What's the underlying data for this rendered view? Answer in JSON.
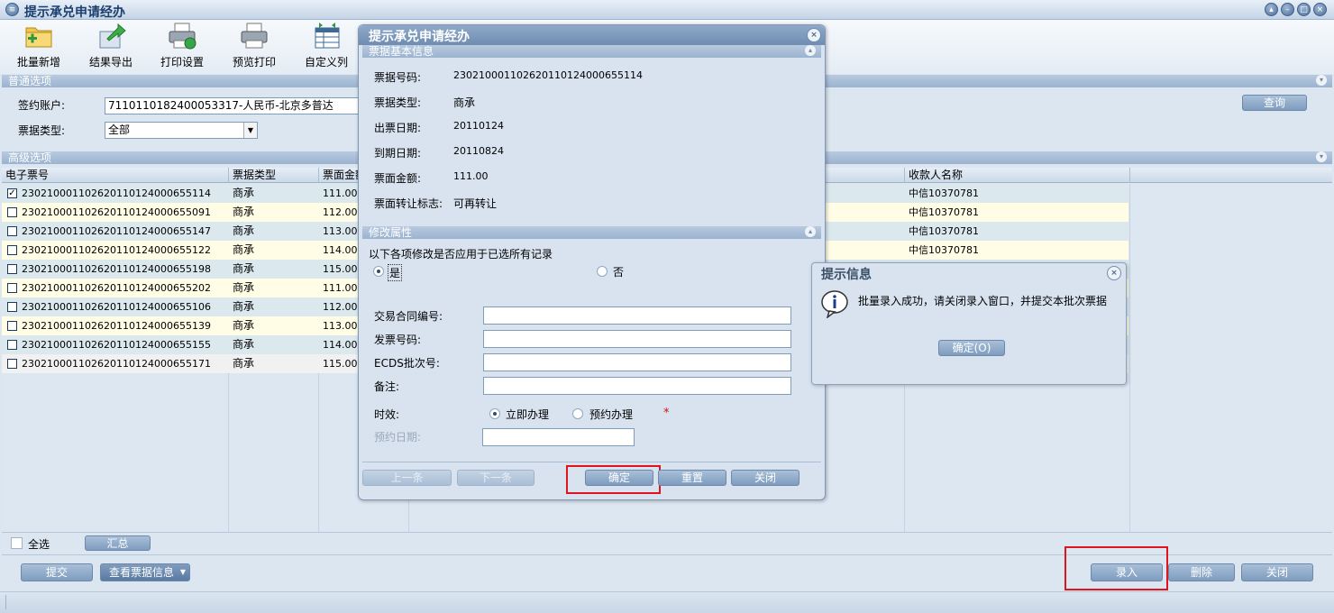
{
  "window": {
    "title": "提示承兑申请经办"
  },
  "toolbar": {
    "items": [
      {
        "label": "批量新增",
        "icon": "folder-add-icon"
      },
      {
        "label": "结果导出",
        "icon": "export-arrow-icon"
      },
      {
        "label": "打印设置",
        "icon": "printer-settings-icon"
      },
      {
        "label": "预览打印",
        "icon": "printer-preview-icon"
      },
      {
        "label": "自定义列",
        "icon": "custom-columns-icon"
      }
    ]
  },
  "normal_options": {
    "title": "普通选项",
    "account_label": "签约账户:",
    "account_value": "7110110182400053317-人民币-北京多普达",
    "type_label": "票据类型:",
    "type_value": "全部",
    "query_button": "查询"
  },
  "advanced_options": {
    "title": "高级选项"
  },
  "table": {
    "columns": [
      "电子票号",
      "票据类型",
      "票面金额",
      "收款人名称"
    ],
    "rows": [
      {
        "checked": true,
        "no": "230210001102620110124000655114",
        "type": "商承",
        "amount": "111.00",
        "payee": "中信10370781"
      },
      {
        "checked": false,
        "no": "230210001102620110124000655091",
        "type": "商承",
        "amount": "112.00",
        "payee": "中信10370781"
      },
      {
        "checked": false,
        "no": "230210001102620110124000655147",
        "type": "商承",
        "amount": "113.00",
        "payee": "中信10370781"
      },
      {
        "checked": false,
        "no": "230210001102620110124000655122",
        "type": "商承",
        "amount": "114.00",
        "payee": "中信10370781"
      },
      {
        "checked": false,
        "no": "230210001102620110124000655198",
        "type": "商承",
        "amount": "115.00",
        "payee": ""
      },
      {
        "checked": false,
        "no": "230210001102620110124000655202",
        "type": "商承",
        "amount": "111.00",
        "payee": ""
      },
      {
        "checked": false,
        "no": "230210001102620110124000655106",
        "type": "商承",
        "amount": "112.00",
        "payee": ""
      },
      {
        "checked": false,
        "no": "230210001102620110124000655139",
        "type": "商承",
        "amount": "113.00",
        "payee": ""
      },
      {
        "checked": false,
        "no": "230210001102620110124000655155",
        "type": "商承",
        "amount": "114.00",
        "payee": ""
      },
      {
        "checked": false,
        "no": "230210001102620110124000655171",
        "type": "商承",
        "amount": "115.00",
        "payee": ""
      }
    ]
  },
  "footer": {
    "select_all": "全选",
    "summary": "汇总",
    "submit": "提交",
    "view_info": "查看票据信息",
    "enter": "录入",
    "delete": "删除",
    "close": "关闭"
  },
  "modal": {
    "title": "提示承兑申请经办",
    "basic_section": "票据基本信息",
    "fields": [
      {
        "label": "票据号码:",
        "value": "230210001102620110124000655114"
      },
      {
        "label": "票据类型:",
        "value": "商承"
      },
      {
        "label": "出票日期:",
        "value": "20110124"
      },
      {
        "label": "到期日期:",
        "value": "20110824"
      },
      {
        "label": "票面金额:",
        "value": "111.00"
      },
      {
        "label": "票面转让标志:",
        "value": "可再转让"
      }
    ],
    "modify_section": "修改属性",
    "apply_question": "以下各项修改是否应用于已选所有记录",
    "yes": "是",
    "no": "否",
    "inputs": [
      {
        "label": "交易合同编号:",
        "value": ""
      },
      {
        "label": "发票号码:",
        "value": ""
      },
      {
        "label": "ECDS批次号:",
        "value": ""
      },
      {
        "label": "备注:",
        "value": ""
      }
    ],
    "timeliness_label": "时效:",
    "immediate": "立即办理",
    "scheduled": "预约办理",
    "required_mark": "*",
    "schedule_date_label": "预约日期:",
    "prev": "上一条",
    "next": "下一条",
    "confirm": "确定",
    "reset": "重置",
    "close": "关闭"
  },
  "message": {
    "title": "提示信息",
    "text": "批量录入成功，请关闭录入窗口，并提交本批次票据",
    "ok": "确定(O)"
  },
  "colors": {
    "accent": "#7e9cbf",
    "highlight_red": "#e0141e",
    "row_blue": "#dbe9ee",
    "row_yellow": "#fffde6"
  }
}
